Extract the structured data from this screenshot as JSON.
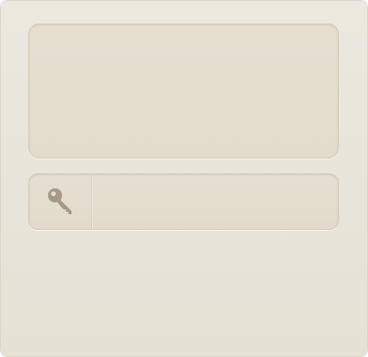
{
  "dialog": {
    "message_text": "",
    "password_value": "",
    "password_placeholder": "",
    "key_icon": "key-icon"
  },
  "colors": {
    "panel_bg": "#e9e4da",
    "field_bg": "#e4ddcf",
    "field_border": "#d2c9b7",
    "icon_color": "#a79a84"
  }
}
